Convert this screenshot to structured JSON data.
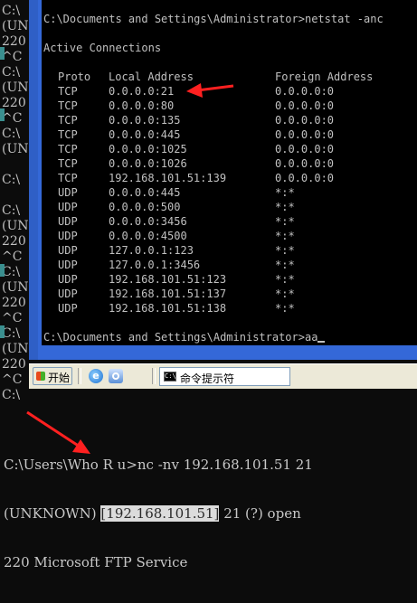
{
  "background_console": {
    "gutter_lines": [
      "C:\\",
      "(UN",
      "220",
      "^C",
      "C:\\",
      "(UN",
      "220",
      "^C",
      "C:\\",
      "(UN",
      "",
      "C:\\",
      "",
      "C:\\",
      "(UN",
      "220",
      "^C",
      "C:\\",
      "(UN",
      "220",
      "^C",
      "C:\\",
      "(UN",
      "220",
      "^C",
      "C:\\"
    ],
    "bottom_line_1": "C:\\Users\\Who R u>nc -nv 192.168.101.51 21",
    "bottom_line_2_prefix": "(UNKNOWN) ",
    "bottom_line_2_highlight": "[192.168.101.51]",
    "bottom_line_2_suffix": " 21 (?) open",
    "bottom_line_3": "220 Microsoft FTP Service"
  },
  "xp_console": {
    "command_line": "C:\\Documents and Settings\\Administrator>netstat -anc",
    "heading": "Active Connections",
    "columns": [
      "Proto",
      "Local Address",
      "Foreign Address"
    ],
    "rows": [
      [
        "TCP",
        "0.0.0.0:21",
        "0.0.0.0:0"
      ],
      [
        "TCP",
        "0.0.0.0:80",
        "0.0.0.0:0"
      ],
      [
        "TCP",
        "0.0.0.0:135",
        "0.0.0.0:0"
      ],
      [
        "TCP",
        "0.0.0.0:445",
        "0.0.0.0:0"
      ],
      [
        "TCP",
        "0.0.0.0:1025",
        "0.0.0.0:0"
      ],
      [
        "TCP",
        "0.0.0.0:1026",
        "0.0.0.0:0"
      ],
      [
        "TCP",
        "192.168.101.51:139",
        "0.0.0.0:0"
      ],
      [
        "UDP",
        "0.0.0.0:445",
        "*:*"
      ],
      [
        "UDP",
        "0.0.0.0:500",
        "*:*"
      ],
      [
        "UDP",
        "0.0.0.0:3456",
        "*:*"
      ],
      [
        "UDP",
        "0.0.0.0:4500",
        "*:*"
      ],
      [
        "UDP",
        "127.0.0.1:123",
        "*:*"
      ],
      [
        "UDP",
        "127.0.0.1:3456",
        "*:*"
      ],
      [
        "UDP",
        "192.168.101.51:123",
        "*:*"
      ],
      [
        "UDP",
        "192.168.101.51:137",
        "*:*"
      ],
      [
        "UDP",
        "192.168.101.51:138",
        "*:*"
      ]
    ],
    "prompt_line": "C:\\Documents and Settings\\Administrator>aa"
  },
  "taskbar": {
    "start_label": "开始",
    "ie_glyph": "e",
    "cmd_icon_text": "C:\\",
    "cmd_task_label": "命令提示符"
  },
  "colors": {
    "annotation_red": "#ff2020",
    "xp_frame_blue": "#3468d8",
    "console_text": "#c0c0c0"
  }
}
